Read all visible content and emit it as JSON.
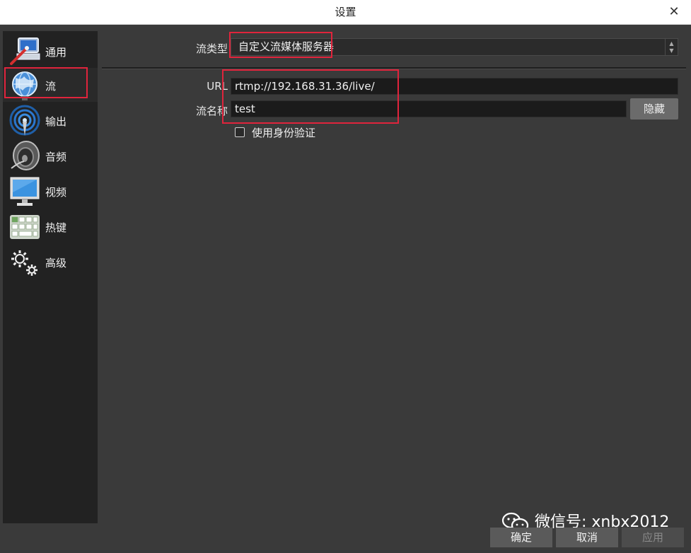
{
  "window": {
    "title": "设置",
    "close_glyph": "✕"
  },
  "sidebar": {
    "items": [
      {
        "label": "通用",
        "icon": "general-settings-icon"
      },
      {
        "label": "流",
        "icon": "globe-icon"
      },
      {
        "label": "输出",
        "icon": "broadcast-antenna-icon"
      },
      {
        "label": "音频",
        "icon": "speaker-icon"
      },
      {
        "label": "视频",
        "icon": "monitor-icon"
      },
      {
        "label": "热键",
        "icon": "keyboard-icon"
      },
      {
        "label": "高级",
        "icon": "gears-icon"
      }
    ],
    "selected_index": 1
  },
  "stream": {
    "type_label": "流类型",
    "type_value": "自定义流媒体服务器",
    "url_label": "URL",
    "url_value": "rtmp://192.168.31.36/live/",
    "key_label": "流名称",
    "key_value": "test",
    "hide_button": "隐藏",
    "auth_checkbox_label": "使用身份验证",
    "auth_checked": false
  },
  "footer": {
    "ok": "确定",
    "cancel": "取消",
    "apply": "应用"
  },
  "watermark": {
    "text": "微信号: xnbx2012"
  },
  "colors": {
    "highlight_box": "#e0243c",
    "sidebar_bg": "#222222",
    "panel_bg": "#3a3a3a"
  }
}
